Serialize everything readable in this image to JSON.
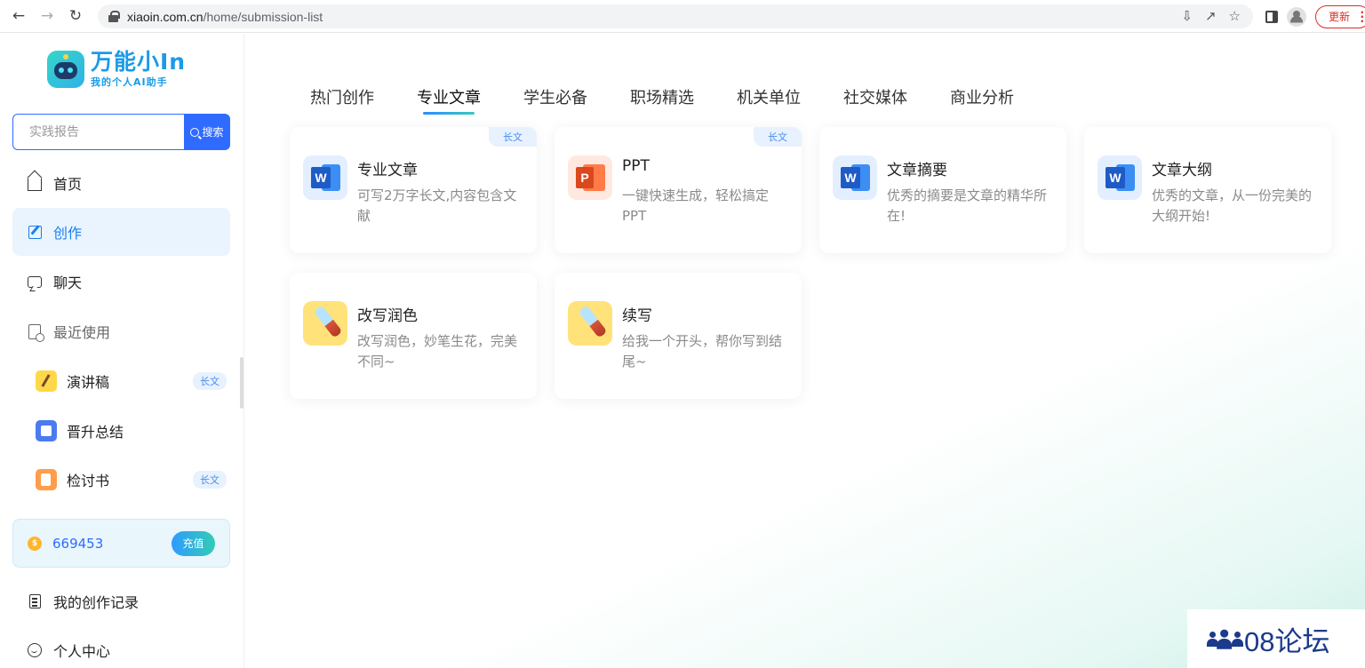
{
  "browser": {
    "url_host": "xiaoin.com.cn",
    "url_path": "/home/submission-list",
    "update_label": "更新"
  },
  "sidebar": {
    "logo_title": "万能小In",
    "logo_subtitle": "我的个人AI助手",
    "search": {
      "placeholder": "实践报告",
      "button_label": "搜索"
    },
    "menu": [
      {
        "label": "首页",
        "icon": "home-icon"
      },
      {
        "label": "创作",
        "icon": "edit-icon",
        "active": true
      },
      {
        "label": "聊天",
        "icon": "chat-icon"
      },
      {
        "label": "最近使用",
        "icon": "recent-icon"
      }
    ],
    "recent": [
      {
        "label": "演讲稿",
        "icon": "microphone-icon",
        "tag": "长文"
      },
      {
        "label": "晋升总结",
        "icon": "document-icon",
        "tag": ""
      },
      {
        "label": "检讨书",
        "icon": "note-icon",
        "tag": "长文"
      }
    ],
    "points": {
      "value": "669453",
      "coin_symbol": "$",
      "recharge_label": "充值"
    },
    "bottom_menu": [
      {
        "label": "我的创作记录",
        "icon": "list-icon"
      },
      {
        "label": "个人中心",
        "icon": "user-icon"
      }
    ]
  },
  "main": {
    "tabs": [
      {
        "label": "热门创作"
      },
      {
        "label": "专业文章",
        "active": true
      },
      {
        "label": "学生必备"
      },
      {
        "label": "职场精选"
      },
      {
        "label": "机关单位"
      },
      {
        "label": "社交媒体"
      },
      {
        "label": "商业分析"
      }
    ],
    "cards": [
      {
        "title": "专业文章",
        "desc": "可写2万字长文,内容包含文献",
        "icon": "word-icon",
        "badge": "长文"
      },
      {
        "title": "PPT",
        "desc": "一键快速生成，轻松搞定PPT",
        "icon": "ppt-icon",
        "badge": "长文"
      },
      {
        "title": "文章摘要",
        "desc": "优秀的摘要是文章的精华所在!",
        "icon": "word-icon",
        "badge": ""
      },
      {
        "title": "文章大纲",
        "desc": "优秀的文章，从一份完美的大纲开始!",
        "icon": "word-icon",
        "badge": ""
      },
      {
        "title": "改写润色",
        "desc": "改写润色，妙笔生花，完美不同~",
        "icon": "pen-icon",
        "badge": ""
      },
      {
        "title": "续写",
        "desc": "给我一个开头，帮你写到结尾~",
        "icon": "pen-icon",
        "badge": ""
      }
    ]
  },
  "watermark": {
    "text": "08论坛"
  },
  "colors": {
    "accent": "#2f6bff",
    "active_bg": "#e9f4fe",
    "badge_text": "#4c8dea"
  }
}
